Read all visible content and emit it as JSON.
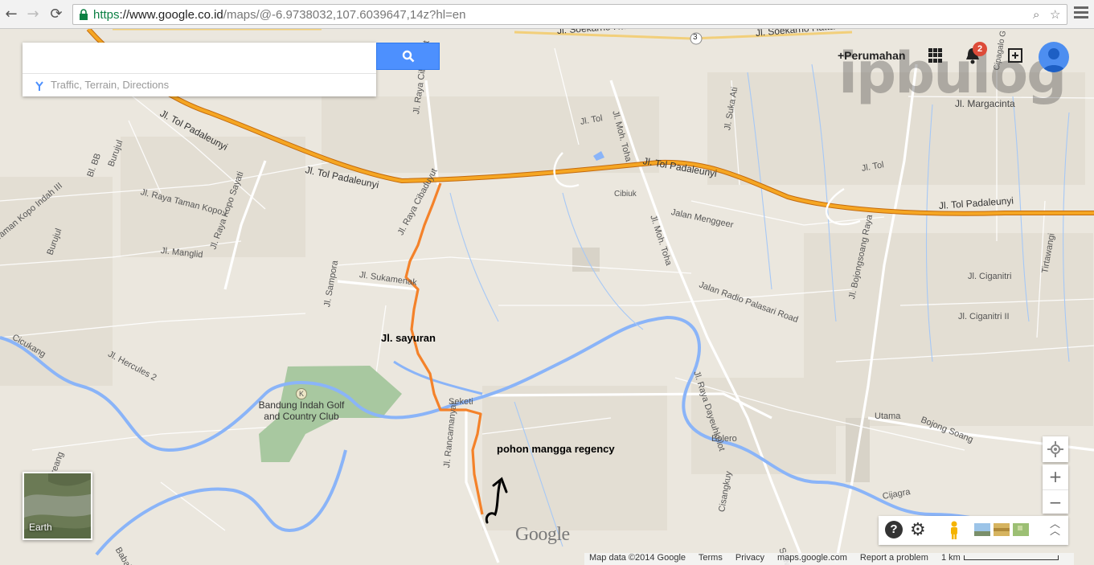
{
  "browser": {
    "url_https": "https",
    "url_host": "://www.google.co.id",
    "url_path": "/maps/@-6.9738032,107.6039647,14z?hl=en"
  },
  "search": {
    "placeholder": "",
    "button_icon": "search-icon",
    "sub_label": "Traffic, Terrain, Directions"
  },
  "account": {
    "name": "+Perumahan",
    "notification_count": "2",
    "watermark": "ipbulog"
  },
  "map": {
    "labels": {
      "toll_nw": "Jl. Tol Padaleunyi",
      "toll_mid": "Jl. Tol Padaleunyi",
      "toll_east": "Jl. Tol Padaleunyi",
      "soekarno1": "Jl. Soekarno Hatta",
      "soekarno2": "Jl. Soekarno Hatta",
      "route_3": "3",
      "margacinta": "Jl. Margacinta",
      "moh_toha_n": "Jl. Moh. Toha",
      "moh_toha_s": "Jl. Moh. Toha",
      "jl_tol": "Jl. Tol",
      "jl_tol2": "Jl. Tol",
      "sukaati": "Jl. Suka Ati",
      "cibiuk": "Cibiuk",
      "menggeer": "Jalan Menggeer",
      "palasari": "Jalan Radio Palasari Road",
      "dayeuhkolot": "Jl. Raya Dayeuhkolot",
      "cibaduyut1": "Jl. Raya Cibaduyut",
      "cibaduyut2": "Jl. Raya Cibaduyut",
      "sukamenak": "Jl. Sukamenak",
      "sampora": "Jl. Sampora",
      "kopo_sayati": "Jl. Raya Kopo Sayati",
      "taman_kopo": "Jl. Raya Taman Kopo I",
      "kopo_indah": "Taman Kopo Indah III",
      "bb": "Bl. BB",
      "burujul": "Burujul",
      "burujul2": "Burujul",
      "manglid": "Jl. Manglid",
      "cicukang": "Cicukang",
      "hercules": "Jl. Hercules 2",
      "golf": "Bandung Indah Golf and Country Club",
      "seketi": "Seketi",
      "rancamanyar": "Jl. Rancamanyar",
      "bojongsoang_raya": "Jl. Bojongsoang Raya",
      "ciganitri": "Jl. Ciganitri",
      "ciganitri2": "Jl. Ciganitri II",
      "tirtawangi": "Tirtawangi",
      "utama": "Utama",
      "bojong_soang": "Bojong Soang",
      "bolero": "Bolero",
      "cijagra": "Cijagra",
      "cisangkuy": "Cisangkuy",
      "siliwangi": "Siliwangi",
      "babakan": "Babakan",
      "kreang": "Kreang",
      "cijawuk": "Cipagalo G"
    },
    "annotations": {
      "sayuran": "Jl. sayuran",
      "regency": "pohon mangga regency"
    }
  },
  "earth_label": "Earth",
  "controls": {
    "zoom_in": "+",
    "zoom_out": "−",
    "help": "?"
  },
  "footer": {
    "map_data": "Map data ©2014 Google",
    "terms": "Terms",
    "privacy": "Privacy",
    "site": "maps.google.com",
    "report": "Report a problem",
    "scale": "1 km"
  },
  "logo": "Google",
  "colors": {
    "land": "#ebe7de",
    "water": "#8ab4f8",
    "highway": "#f5a623",
    "route": "#f4822a",
    "park": "#a8c8a0"
  }
}
